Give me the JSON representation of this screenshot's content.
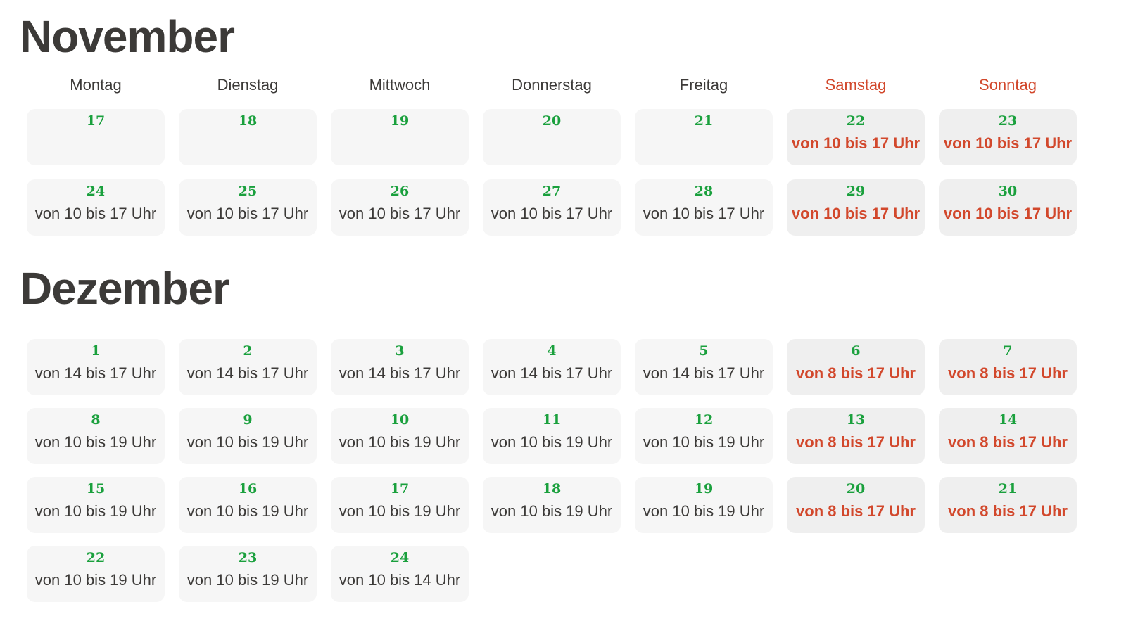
{
  "weekdays": [
    {
      "label": "Montag",
      "weekend": false
    },
    {
      "label": "Dienstag",
      "weekend": false
    },
    {
      "label": "Mittwoch",
      "weekend": false
    },
    {
      "label": "Donnerstag",
      "weekend": false
    },
    {
      "label": "Freitag",
      "weekend": false
    },
    {
      "label": "Samstag",
      "weekend": true
    },
    {
      "label": "Sonntag",
      "weekend": true
    }
  ],
  "colors": {
    "title": "#3c3a38",
    "day_number": "#1aa03d",
    "weekend_text": "#d2482c",
    "cell_bg": "#f6f6f6",
    "weekend_cell_bg": "#efefef"
  },
  "months": [
    {
      "name": "November",
      "weeks": [
        [
          {
            "day": "17",
            "hours": ""
          },
          {
            "day": "18",
            "hours": ""
          },
          {
            "day": "19",
            "hours": ""
          },
          {
            "day": "20",
            "hours": ""
          },
          {
            "day": "21",
            "hours": ""
          },
          {
            "day": "22",
            "hours": "von 10 bis 17 Uhr"
          },
          {
            "day": "23",
            "hours": "von 10 bis 17 Uhr"
          }
        ],
        [
          {
            "day": "24",
            "hours": "von 10 bis 17 Uhr"
          },
          {
            "day": "25",
            "hours": "von 10 bis 17 Uhr"
          },
          {
            "day": "26",
            "hours": "von 10 bis 17 Uhr"
          },
          {
            "day": "27",
            "hours": "von 10 bis 17 Uhr"
          },
          {
            "day": "28",
            "hours": "von 10 bis 17 Uhr"
          },
          {
            "day": "29",
            "hours": "von 10 bis 17 Uhr"
          },
          {
            "day": "30",
            "hours": "von 10 bis 17 Uhr"
          }
        ]
      ]
    },
    {
      "name": "Dezember",
      "weeks": [
        [
          {
            "day": "1",
            "hours": "von 14 bis 17 Uhr"
          },
          {
            "day": "2",
            "hours": "von 14 bis 17 Uhr"
          },
          {
            "day": "3",
            "hours": "von 14 bis 17 Uhr"
          },
          {
            "day": "4",
            "hours": "von 14 bis 17 Uhr"
          },
          {
            "day": "5",
            "hours": "von 14 bis 17 Uhr"
          },
          {
            "day": "6",
            "hours": "von 8 bis 17 Uhr"
          },
          {
            "day": "7",
            "hours": "von 8 bis 17 Uhr"
          }
        ],
        [
          {
            "day": "8",
            "hours": "von 10 bis 19 Uhr"
          },
          {
            "day": "9",
            "hours": "von 10 bis 19 Uhr"
          },
          {
            "day": "10",
            "hours": "von 10 bis 19 Uhr"
          },
          {
            "day": "11",
            "hours": "von 10 bis 19 Uhr"
          },
          {
            "day": "12",
            "hours": "von 10 bis 19 Uhr"
          },
          {
            "day": "13",
            "hours": "von 8 bis 17 Uhr"
          },
          {
            "day": "14",
            "hours": "von 8 bis 17 Uhr"
          }
        ],
        [
          {
            "day": "15",
            "hours": "von 10 bis 19 Uhr"
          },
          {
            "day": "16",
            "hours": "von 10 bis 19 Uhr"
          },
          {
            "day": "17",
            "hours": "von 10 bis 19 Uhr"
          },
          {
            "day": "18",
            "hours": "von 10 bis 19 Uhr"
          },
          {
            "day": "19",
            "hours": "von 10 bis 19 Uhr"
          },
          {
            "day": "20",
            "hours": "von 8 bis 17 Uhr"
          },
          {
            "day": "21",
            "hours": "von 8 bis 17 Uhr"
          }
        ],
        [
          {
            "day": "22",
            "hours": "von 10 bis 19 Uhr"
          },
          {
            "day": "23",
            "hours": "von 10 bis 19 Uhr"
          },
          {
            "day": "24",
            "hours": "von 10 bis 14 Uhr"
          }
        ]
      ]
    }
  ]
}
